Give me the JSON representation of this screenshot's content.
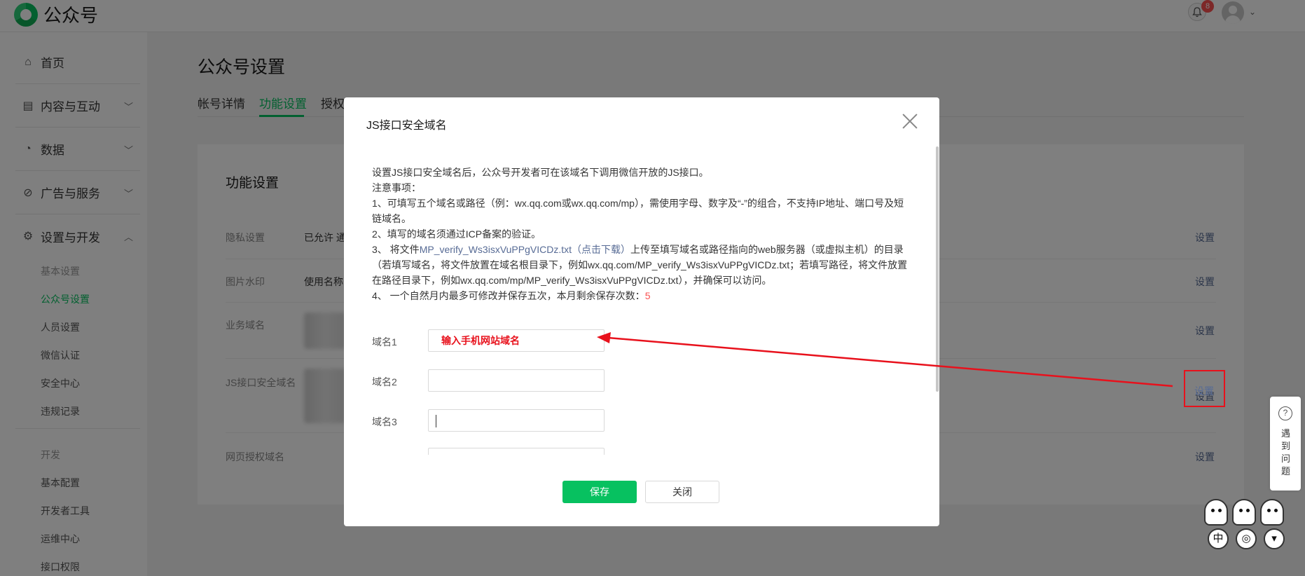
{
  "header": {
    "app_name": "公众号",
    "notification_count": "8"
  },
  "sidebar": {
    "groups": [
      {
        "label": "首页",
        "icon": "home-icon"
      },
      {
        "label": "内容与互动",
        "icon": "document-icon"
      },
      {
        "label": "数据",
        "icon": "pie-chart-icon"
      },
      {
        "label": "广告与服务",
        "icon": "compass-icon"
      },
      {
        "label": "设置与开发",
        "icon": "gear-icon"
      }
    ],
    "settings_items": [
      "基本设置",
      "公众号设置",
      "人员设置",
      "微信认证",
      "安全中心",
      "违规记录"
    ],
    "dev_section": "开发",
    "dev_items": [
      "基本配置",
      "开发者工具",
      "运维中心",
      "接口权限"
    ]
  },
  "main": {
    "page_title": "公众号设置",
    "tabs": [
      "帐号详情",
      "功能设置",
      "授权"
    ],
    "active_tab": "功能设置",
    "card_title": "功能设置",
    "rows": [
      {
        "label": "隐私设置",
        "value": "已允许 通",
        "action": "设置"
      },
      {
        "label": "图片水印",
        "value": "使用名称",
        "action": "设置"
      },
      {
        "label": "业务域名",
        "value": "",
        "action": "设置"
      },
      {
        "label": "JS接口安全域名",
        "value": "",
        "action": "设置"
      },
      {
        "label": "网页授权域名",
        "value": "",
        "action": "设置"
      }
    ]
  },
  "dialog": {
    "title": "JS接口安全域名",
    "intro": "设置JS接口安全域名后，公众号开发者可在该域名下调用微信开放的JS接口。",
    "notes_heading": "注意事项：",
    "note1": "1、可填写五个域名或路径（例：wx.qq.com或wx.qq.com/mp），需使用字母、数字及“-”的组合，不支持IP地址、端口号及短链域名。",
    "note2": "2、填写的域名须通过ICP备案的验证。",
    "note3_prefix": "3、 将文件",
    "note3_file": "MP_verify_Ws3isxVuPPgVICDz.txt（点击下载）",
    "note3_suffix": "上传至填写域名或路径指向的web服务器（或虚拟主机）的目录（若填写域名，将文件放置在域名根目录下，例如wx.qq.com/MP_verify_Ws3isxVuPPgVICDz.txt；若填写路径，将文件放置在路径目录下，例如wx.qq.com/mp/MP_verify_Ws3isxVuPPgVICDz.txt），并确保可以访问。",
    "note4_prefix": "4、 一个自然月内最多可修改并保存五次，本月剩余保存次数：",
    "note4_count": "5",
    "fields": [
      {
        "label": "域名1",
        "value": "输入手机网站域名"
      },
      {
        "label": "域名2",
        "value": ""
      },
      {
        "label": "域名3",
        "value": ""
      }
    ],
    "save_label": "保存",
    "close_label": "关闭"
  },
  "help_widget": {
    "icon_glyph": "?",
    "label": "遇到问题"
  },
  "sticker_widget": {
    "badge_label": "中"
  },
  "colors": {
    "accent": "#07c160",
    "link": "#576b95",
    "annotation": "#e8111c",
    "overlay": "rgba(0,0,0,0.5)"
  }
}
